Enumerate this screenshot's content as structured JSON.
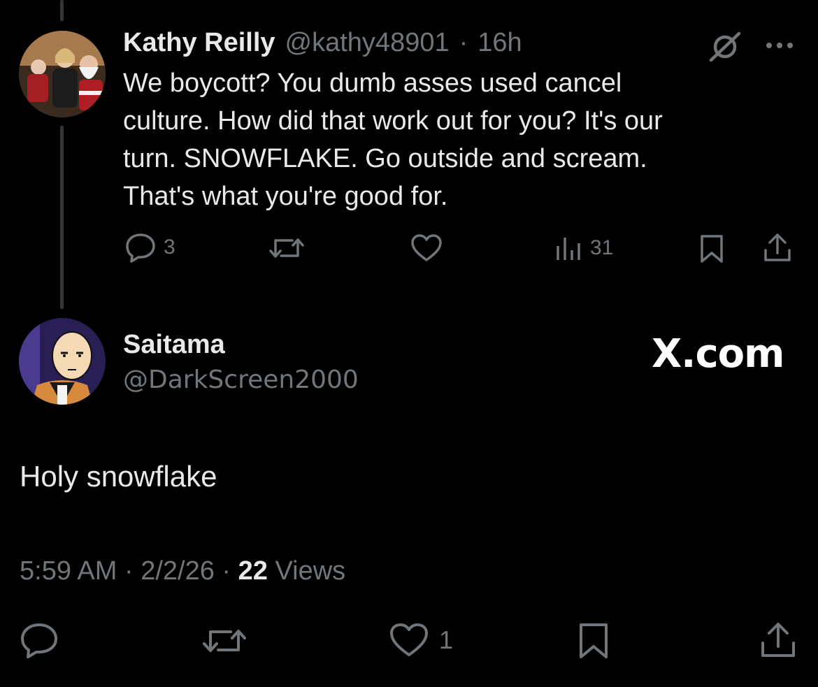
{
  "parent_tweet": {
    "author_name": "Kathy Reilly",
    "handle": "@kathy48901",
    "separator": "·",
    "time": "16h",
    "text_lines": [
      "We boycott? You dumb asses used cancel",
      "culture. How did that work out for you? It's our",
      "turn. SNOWFLAKE. Go outside and scream.",
      "That's what you're good for."
    ],
    "reply_count": "3",
    "views_count": "31",
    "more_label": "···"
  },
  "reply_tweet": {
    "author_name": "Saitama",
    "handle": "@DarkScreen2000",
    "watermark": "X.com",
    "text": "Holy snowflake",
    "time": "5:59 AM",
    "date": "2/2/26",
    "views_number": "22",
    "views_label": "Views",
    "separator": "·",
    "like_count": "1"
  },
  "colors": {
    "background": "#000000",
    "text_primary": "#e7e9ea",
    "text_muted": "#71767b",
    "thread_line": "#333639"
  },
  "icons": {
    "reply": "reply-icon",
    "retweet": "retweet-icon",
    "like": "heart-icon",
    "views": "views-chart-icon",
    "bookmark": "bookmark-icon",
    "share": "share-icon",
    "grok": "grok-icon",
    "more": "more-dots-icon"
  }
}
